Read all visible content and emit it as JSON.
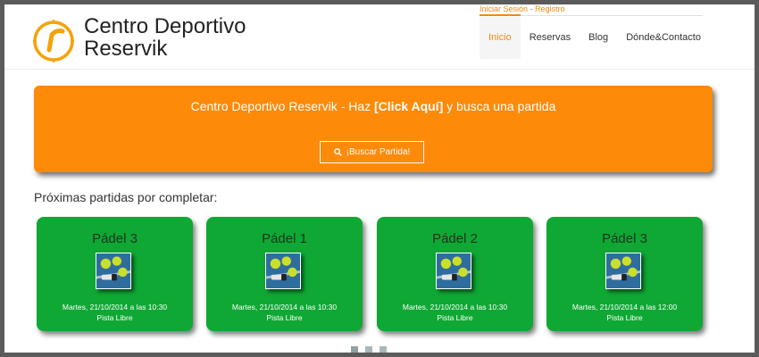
{
  "brand": {
    "name_line1": "Centro Deportivo",
    "name_line2": "Reservik"
  },
  "top_links": {
    "login": "Iniciar Sesión",
    "separator": "-",
    "register": "Registro"
  },
  "nav": [
    "Inicio",
    "Reservas",
    "Blog",
    "Dónde&Contacto"
  ],
  "nav_active": "Inicio",
  "banner": {
    "text_before": "Centro Deportivo Reservik - Haz ",
    "text_bold": "[Click Aquí]",
    "text_after": " y busca una partida",
    "button_label": "¡Buscar Partida!"
  },
  "section_title": "Próximas partidas por completar:",
  "cards": [
    {
      "title": "Pádel 3",
      "date": "Martes, 21/10/2014 a las 10:30",
      "court": "Pista Libre"
    },
    {
      "title": "Pádel 1",
      "date": "Martes, 21/10/2014 a las 10:30",
      "court": "Pista Libre"
    },
    {
      "title": "Pádel 2",
      "date": "Martes, 21/10/2014 a las 10:30",
      "court": "Pista Libre"
    },
    {
      "title": "Pádel 3",
      "date": "Martes, 21/10/2014 a las 12:00",
      "court": "Pista Libre"
    }
  ],
  "pager": {
    "count": 3,
    "active_index": 0
  },
  "colors": {
    "accent": "#fd8a08",
    "card_green": "#0fa834",
    "link_orange": "#f08a0f"
  },
  "icons": [
    "logo-clock-icon",
    "search-icon",
    "padel-balls-icon"
  ]
}
